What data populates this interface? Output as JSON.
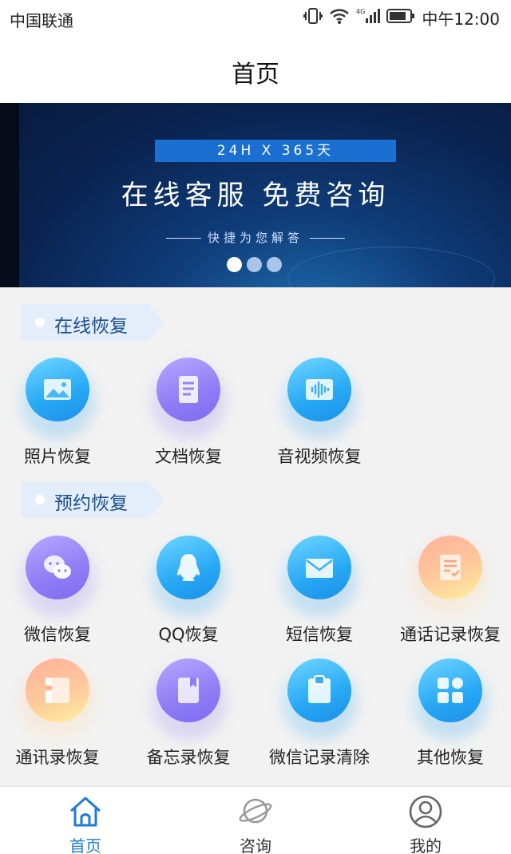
{
  "status_bar": {
    "carrier": "中国联通",
    "time": "中午12:00",
    "network": "4G"
  },
  "header": {
    "title": "首页"
  },
  "banner": {
    "tag": "24H X 365天",
    "title": "在线客服 免费咨询",
    "subtitle": "快捷为您解答",
    "dots": 3,
    "active_dot": 0
  },
  "sections": [
    {
      "title": "在线恢复",
      "items": [
        {
          "label": "照片恢复",
          "icon": "image-icon",
          "color": "blue"
        },
        {
          "label": "文档恢复",
          "icon": "document-icon",
          "color": "purple"
        },
        {
          "label": "音视频恢复",
          "icon": "audio-wave-icon",
          "color": "blue"
        }
      ]
    },
    {
      "title": "预约恢复",
      "items": [
        {
          "label": "微信恢复",
          "icon": "wechat-icon",
          "color": "purple"
        },
        {
          "label": "QQ恢复",
          "icon": "qq-penguin-icon",
          "color": "blue"
        },
        {
          "label": "短信恢复",
          "icon": "envelope-icon",
          "color": "blue"
        },
        {
          "label": "通话记录恢复",
          "icon": "call-log-icon",
          "color": "peach"
        },
        {
          "label": "通讯录恢复",
          "icon": "contacts-book-icon",
          "color": "peach"
        },
        {
          "label": "备忘录恢复",
          "icon": "memo-bookmark-icon",
          "color": "purple"
        },
        {
          "label": "微信记录清除",
          "icon": "clipboard-icon",
          "color": "blue"
        },
        {
          "label": "其他恢复",
          "icon": "apps-grid-icon",
          "color": "blue"
        }
      ]
    }
  ],
  "bottom_nav": [
    {
      "label": "首页",
      "icon": "home-icon",
      "active": true
    },
    {
      "label": "咨询",
      "icon": "planet-icon",
      "active": false
    },
    {
      "label": "我的",
      "icon": "user-icon",
      "active": false
    }
  ],
  "colors": {
    "accent": "#1e7bd8",
    "section_text": "#1a4f8f"
  }
}
